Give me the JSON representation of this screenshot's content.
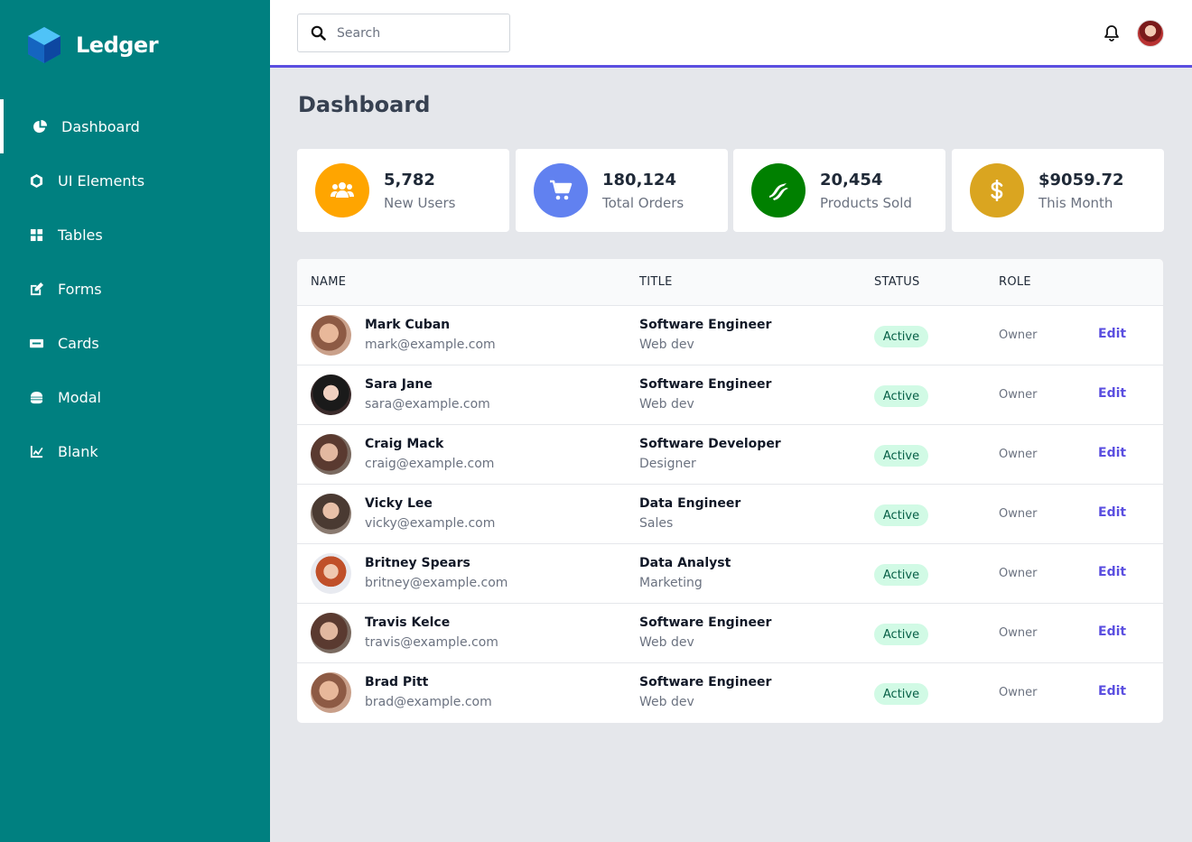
{
  "app": {
    "name": "Ledger"
  },
  "sidebar": {
    "items": [
      {
        "label": "Dashboard",
        "icon": "pie-chart-icon",
        "active": true
      },
      {
        "label": "UI Elements",
        "icon": "cube-icon"
      },
      {
        "label": "Tables",
        "icon": "grid-icon"
      },
      {
        "label": "Forms",
        "icon": "edit-icon"
      },
      {
        "label": "Cards",
        "icon": "credit-card-icon"
      },
      {
        "label": "Modal",
        "icon": "hamburger-icon"
      },
      {
        "label": "Blank",
        "icon": "chart-line-icon"
      }
    ]
  },
  "header": {
    "search_placeholder": "Search",
    "search_value": ""
  },
  "main": {
    "title": "Dashboard",
    "stats": [
      {
        "value": "5,782",
        "label": "New Users",
        "icon": "users-icon",
        "color": "#ffa500"
      },
      {
        "value": "180,124",
        "label": "Total Orders",
        "icon": "cart-icon",
        "color": "#6181f0"
      },
      {
        "value": "20,454",
        "label": "Products Sold",
        "icon": "bacon-icon",
        "color": "#008000"
      },
      {
        "value": "$9059.72",
        "label": "This Month",
        "icon": "dollar-icon",
        "color": "#daa520"
      }
    ],
    "table": {
      "headers": [
        "NAME",
        "TITLE",
        "STATUS",
        "ROLE"
      ],
      "rows": [
        {
          "name": "Mark Cuban",
          "email": "mark@example.com",
          "title": "Software Engineer",
          "subtitle": "Web dev",
          "status": "Active",
          "role": "Owner",
          "action": "Edit"
        },
        {
          "name": "Sara Jane",
          "email": "sara@example.com",
          "title": "Software Engineer",
          "subtitle": "Web dev",
          "status": "Active",
          "role": "Owner",
          "action": "Edit"
        },
        {
          "name": "Craig Mack",
          "email": "craig@example.com",
          "title": "Software Developer",
          "subtitle": "Designer",
          "status": "Active",
          "role": "Owner",
          "action": "Edit"
        },
        {
          "name": "Vicky Lee",
          "email": "vicky@example.com",
          "title": "Data Engineer",
          "subtitle": "Sales",
          "status": "Active",
          "role": "Owner",
          "action": "Edit"
        },
        {
          "name": "Britney Spears",
          "email": "britney@example.com",
          "title": "Data Analyst",
          "subtitle": "Marketing",
          "status": "Active",
          "role": "Owner",
          "action": "Edit"
        },
        {
          "name": "Travis Kelce",
          "email": "travis@example.com",
          "title": "Software Engineer",
          "subtitle": "Web dev",
          "status": "Active",
          "role": "Owner",
          "action": "Edit"
        },
        {
          "name": "Brad Pitt",
          "email": "brad@example.com",
          "title": "Software Engineer",
          "subtitle": "Web dev",
          "status": "Active",
          "role": "Owner",
          "action": "Edit"
        }
      ]
    }
  },
  "colors": {
    "sidebar": "#008080",
    "accent": "#5b4fe0",
    "badge_bg": "#d1fae5",
    "badge_text": "#065f46"
  }
}
